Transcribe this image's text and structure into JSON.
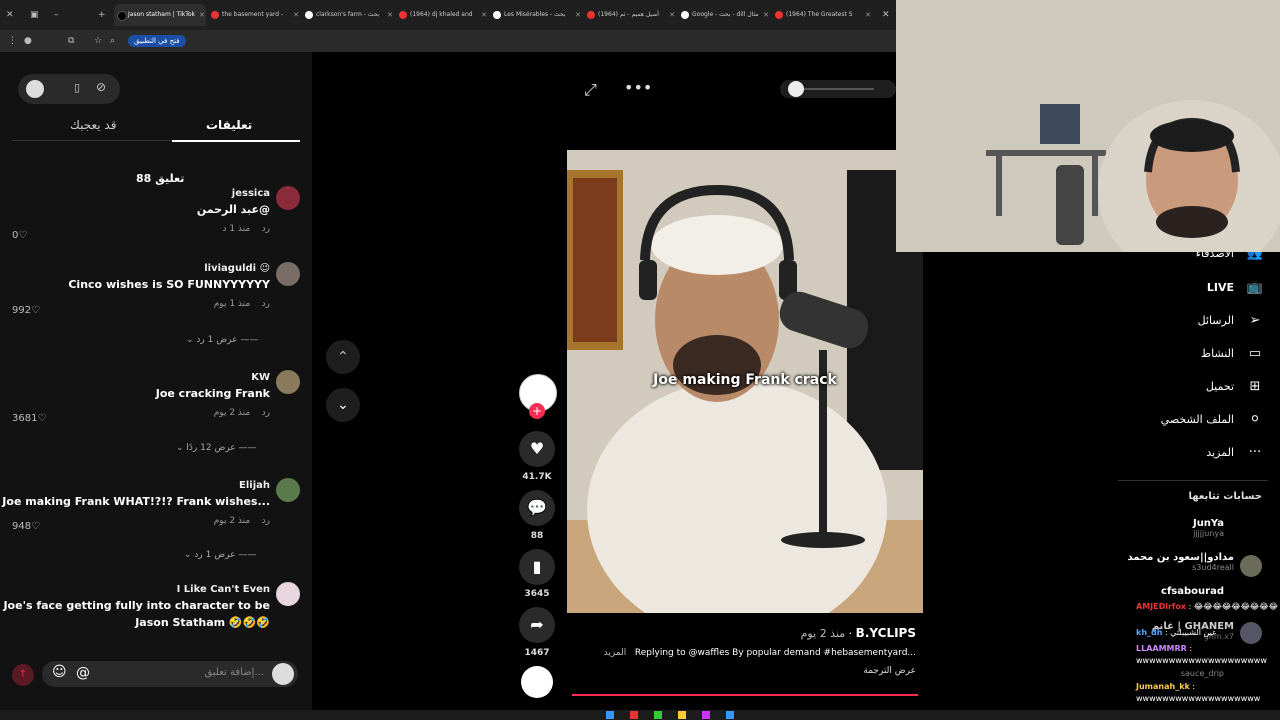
{
  "browser": {
    "tabs": [
      {
        "label": "Jason statham | TikTok",
        "active": true
      },
      {
        "label": "the basement yard -"
      },
      {
        "label": "clarkson's farm - بحث"
      },
      {
        "label": "(1964) dj khaled and"
      },
      {
        "label": "Les Misérables - بحث"
      },
      {
        "label": "(1964) أصيل هميم - ثم"
      },
      {
        "label": "Google - بحث - dill مثال"
      },
      {
        "label": "(1964) The Greatest S"
      }
    ],
    "open_in_app": "فتح في التطبيق"
  },
  "comments_panel": {
    "tab_comments": "تعليقات",
    "tab_you_may_like": "قد يعجبك",
    "count_label": "88 تعليق",
    "comments": [
      {
        "name": "jessica",
        "text": "عبد الرحمن@",
        "meta": "منذ 1 د",
        "reply": "رد",
        "likes": "0",
        "avatar_color": "#8b2a3a"
      },
      {
        "name": "liviaguldi 😉",
        "text": "Cinco wishes is SO FUNNYYYYYY",
        "meta": "منذ 1 يوم",
        "reply": "رد",
        "likes": "992",
        "view_replies": "عرض 1 رد",
        "avatar_color": "#7a6d66"
      },
      {
        "name": "KW",
        "text": "Joe cracking Frank",
        "meta": "منذ 2 يوم",
        "reply": "رد",
        "likes": "3681",
        "view_replies": "عرض 12 ردًا",
        "avatar_color": "#8a7a5c"
      },
      {
        "name": "Elijah",
        "text": "Joe making Frank WHAT!?!? Frank wishes...",
        "meta": "منذ 2 يوم",
        "reply": "رد",
        "likes": "948",
        "view_replies": "عرض 1 رد",
        "avatar_color": "#5b7a4c"
      },
      {
        "name": "I Like Can't Even",
        "text": "Joe's face getting fully into character to be",
        "text2": "Jason Statham 🤣🤣🤣",
        "avatar_color": "#e8d6de"
      }
    ],
    "add_comment_placeholder": "إضافة تعليق..."
  },
  "video": {
    "caption_overlay": "Joe making Frank crack",
    "author": "B.YCLIPS",
    "posted": "منذ 2 يوم",
    "description": "Replying to @waffles By popular demand #hebasementyard...",
    "more": "المزيد",
    "translate": "عرض الترجمة",
    "likes": "41.7K",
    "comments": "88",
    "saves": "3645",
    "shares": "1467"
  },
  "sidebar": {
    "items": [
      {
        "label": "الأصدقاء",
        "icon": "friends-icon"
      },
      {
        "label": "LIVE",
        "icon": "live-icon"
      },
      {
        "label": "الرسائل",
        "icon": "messages-icon"
      },
      {
        "label": "النشاط",
        "icon": "activity-icon"
      },
      {
        "label": "تحميل",
        "icon": "upload-icon"
      },
      {
        "label": "الملف الشخصي",
        "icon": "profile-icon"
      },
      {
        "label": "المزيد",
        "icon": "more-icon"
      }
    ],
    "following_title": "حسابات تتابعها",
    "following": [
      {
        "name": "JunYa",
        "handle": "jjjjjunya"
      },
      {
        "name": "مدادو||سعود بن محمد",
        "handle": "s3ud4reall"
      },
      {
        "name": "cfsabourad",
        "handle": ""
      },
      {
        "name": "غانم | GHANEM",
        "handle": "ghm.x7"
      },
      {
        "name": "",
        "handle": "sauce_drip"
      }
    ]
  },
  "stream_chat": [
    {
      "user": "AMJEDlrfox",
      "text": "😂😂😂😂😂😂😂😂😂"
    },
    {
      "user": "kh_dh",
      "text": "عين الشبيبلتي"
    },
    {
      "user": "LLAAMMRR",
      "text": ""
    },
    {
      "user": "",
      "text": "wwwwwwwwwwwwwwwwwwww"
    },
    {
      "user": "Jumanah_kk",
      "text": ""
    },
    {
      "user": "",
      "text": "wwwwwwwwwwwwwwwwwww"
    }
  ],
  "colors": {
    "accent_red": "#fe2c55",
    "panel_bg": "#121212",
    "chrome_bg": "#1f1f1f"
  }
}
